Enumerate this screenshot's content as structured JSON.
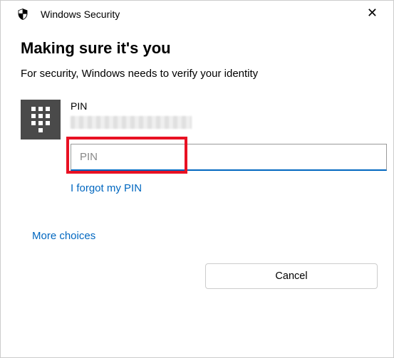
{
  "window": {
    "title": "Windows Security"
  },
  "dialog": {
    "heading": "Making sure it's you",
    "subtext": "For security, Windows needs to verify your identity"
  },
  "pin": {
    "method_label": "PIN",
    "input_placeholder": "PIN",
    "forgot_link": "I forgot my PIN"
  },
  "links": {
    "more_choices": "More choices"
  },
  "buttons": {
    "cancel": "Cancel"
  }
}
